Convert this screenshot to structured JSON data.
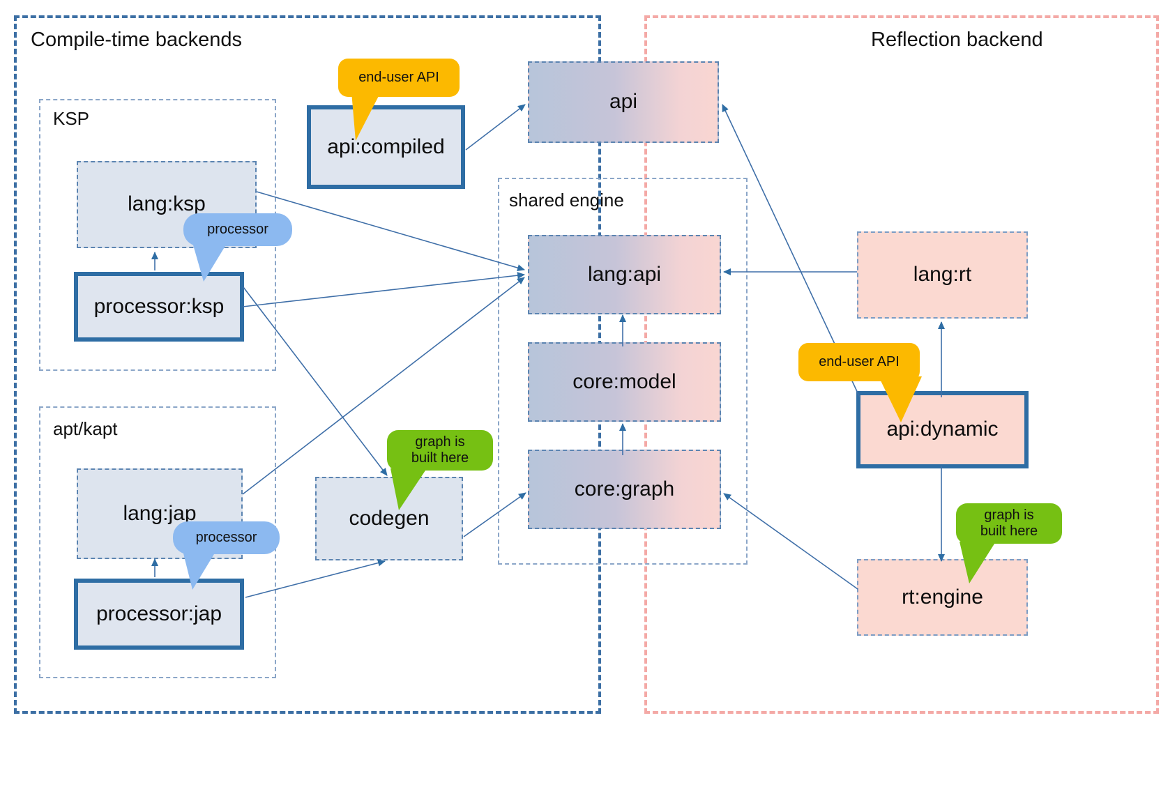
{
  "groups": {
    "compile_time": {
      "label": "Compile-time backends"
    },
    "reflection": {
      "label": "Reflection backend"
    },
    "ksp": {
      "label": "KSP"
    },
    "apt_kapt": {
      "label": "apt/kapt"
    },
    "shared_engine": {
      "label": "shared engine"
    }
  },
  "nodes": {
    "lang_ksp": {
      "label": "lang:ksp"
    },
    "processor_ksp": {
      "label": "processor:ksp"
    },
    "lang_jap": {
      "label": "lang:jap"
    },
    "processor_jap": {
      "label": "processor:jap"
    },
    "api_compiled": {
      "label": "api:compiled"
    },
    "codegen": {
      "label": "codegen"
    },
    "api": {
      "label": "api"
    },
    "lang_api": {
      "label": "lang:api"
    },
    "core_model": {
      "label": "core:model"
    },
    "core_graph": {
      "label": "core:graph"
    },
    "lang_rt": {
      "label": "lang:rt"
    },
    "api_dynamic": {
      "label": "api:dynamic"
    },
    "rt_engine": {
      "label": "rt:engine"
    }
  },
  "callouts": {
    "end_user_api_compiled": {
      "label": "end-user API"
    },
    "end_user_api_dynamic": {
      "label": "end-user API"
    },
    "processor_ksp_badge": {
      "label": "processor"
    },
    "processor_jap_badge": {
      "label": "processor"
    },
    "graph_built_codegen": {
      "label": "graph is\nbuilt here"
    },
    "graph_built_rt": {
      "label": "graph is\nbuilt here"
    }
  },
  "colors": {
    "compile_border": "#3c6fa4",
    "reflection_border": "#f4a9a6",
    "node_border": "#5b84b1",
    "emphasis_border": "#2e6da4",
    "plain_fill": "#dde4ee",
    "pink_fill": "#fbd9d1",
    "gradient_from": "#b7c5da",
    "gradient_to": "#f9d6d2",
    "callout_amber": "#fcb900",
    "callout_light_blue": "#8cb9f0",
    "callout_green": "#76c013",
    "edge": "#3f6fa8"
  },
  "edges": [
    {
      "from": "api_compiled",
      "to": "api",
      "kind": "depends"
    },
    {
      "from": "lang_ksp",
      "to": "lang_api",
      "kind": "depends"
    },
    {
      "from": "processor_ksp",
      "to": "lang_api",
      "kind": "depends"
    },
    {
      "from": "processor_ksp",
      "to": "codegen",
      "kind": "depends"
    },
    {
      "from": "lang_jap",
      "to": "lang_api",
      "kind": "depends"
    },
    {
      "from": "processor_jap",
      "to": "codegen",
      "kind": "depends"
    },
    {
      "from": "processor_ksp_impl",
      "to": "lang_ksp",
      "kind": "processor"
    },
    {
      "from": "processor_jap_impl",
      "to": "lang_jap",
      "kind": "processor"
    },
    {
      "from": "codegen",
      "to": "core_graph",
      "kind": "depends"
    },
    {
      "from": "core_graph",
      "to": "core_model",
      "kind": "depends"
    },
    {
      "from": "core_model",
      "to": "lang_api",
      "kind": "depends"
    },
    {
      "from": "api_dynamic",
      "to": "api",
      "kind": "depends"
    },
    {
      "from": "api_dynamic",
      "to": "lang_rt",
      "kind": "depends"
    },
    {
      "from": "lang_rt",
      "to": "lang_api",
      "kind": "depends"
    },
    {
      "from": "api_dynamic",
      "to": "rt_engine",
      "kind": "depends"
    },
    {
      "from": "rt_engine",
      "to": "core_graph",
      "kind": "depends"
    }
  ]
}
